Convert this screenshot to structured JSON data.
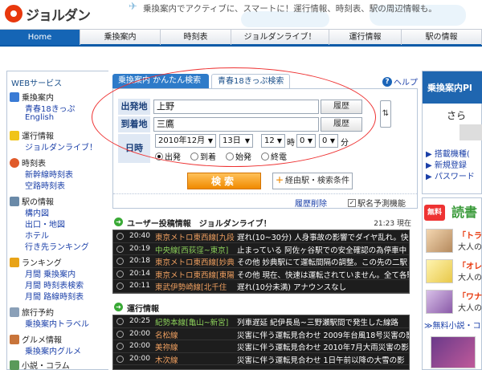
{
  "header": {
    "logo": "ジョルダン",
    "slogan": "乗換案内でアクティブに、スマートに！運行情報、時刻表、駅の周辺情報も。"
  },
  "nav": [
    {
      "label": "Home",
      "active": true
    },
    {
      "label": "乗換案内"
    },
    {
      "label": "時刻表"
    },
    {
      "label": "ジョルダンライブ！"
    },
    {
      "label": "運行情報"
    },
    {
      "label": "駅の情報"
    }
  ],
  "sidebar": {
    "title": "WEBサービス",
    "sections": [
      {
        "label": "乗換案内",
        "icon": "train-icon",
        "links": [
          "青春18きっぷ",
          "English"
        ]
      },
      {
        "label": "運行情報",
        "icon": "warning-icon",
        "links": [
          "ジョルダンライブ！"
        ]
      },
      {
        "label": "時刻表",
        "icon": "clock-icon",
        "links": [
          "新幹線時刻表",
          "空路時刻表"
        ]
      },
      {
        "label": "駅の情報",
        "icon": "station-icon",
        "links": [
          "構内図",
          "出口・地図",
          "ホテル",
          "行き先ランキング"
        ]
      },
      {
        "label": "ランキング",
        "icon": "crown-icon",
        "links": [
          "月間 乗換案内",
          "月間 時刻表検索",
          "月間 路線時刻表"
        ]
      },
      {
        "label": "旅行予約",
        "icon": "plane-icon",
        "links": [
          "乗換案内トラベル"
        ]
      },
      {
        "label": "グルメ情報",
        "icon": "food-icon",
        "links": [
          "乗換案内グルメ"
        ]
      },
      {
        "label": "小説・コラム",
        "icon": "book-icon",
        "links": []
      }
    ]
  },
  "search": {
    "tab_simple": "乗換案内 かんたん検索",
    "tab_seishun": "青春18きっぷ検索",
    "help": "ヘルプ",
    "from_label": "出発地",
    "from_value": "上野",
    "to_label": "到着地",
    "to_value": "三鷹",
    "history_btn": "履歴",
    "datetime_label": "日時",
    "year_month": "2010年12月",
    "day": "13日",
    "hour": "12",
    "hour_suffix": "時",
    "minute_tens": "0",
    "minute_ones": "0",
    "minute_suffix": "分",
    "radios": [
      "出発",
      "到着",
      "始発",
      "終電"
    ],
    "search_btn": "検索",
    "options_btn": "経由駅・検索条件",
    "history_delete": "履歴削除",
    "station_predict": "駅名予測機能"
  },
  "posts": {
    "title": "ユーザー投稿情報　ジョルダンライブ！",
    "time": "21:23 現在",
    "rows": [
      {
        "time": "20:40",
        "line": "東京メトロ東西線[九段",
        "text": "遅れ(10~30分) 人身事故の影響でダイヤ乱れ。快速"
      },
      {
        "time": "20:19",
        "line": "中央線[西荻窪~東京]",
        "text": "止まっている 阿佐ヶ谷駅での安全確認の為停車中",
        "green": true
      },
      {
        "time": "20:18",
        "line": "東京メトロ東西線[妙典",
        "text": "その他 妙典駅にて運転間隔の調整。この先の二駅と"
      },
      {
        "time": "20:14",
        "line": "東京メトロ東西線[東陽",
        "text": "その他 現在、快速は運転されていません。全て各駅停"
      },
      {
        "time": "20:11",
        "line": "東武伊勢崎線[北千住",
        "text": "遅れ(10分未満) アナウンスなし"
      }
    ]
  },
  "ops": {
    "title": "運行情報",
    "rows": [
      {
        "time": "20:25",
        "line": "紀勢本線[亀山~新宮]",
        "text": "列車遅延 紀伊長島~三野瀬駅間で発生した線路",
        "green": true
      },
      {
        "time": "20:00",
        "line": "名松線",
        "text": "災害に伴う運転見合わせ 2009年台風18号災害の影"
      },
      {
        "time": "20:00",
        "line": "美祢線",
        "text": "災害に伴う運転見合わせ 2010年7月大雨災害の影"
      },
      {
        "time": "20:00",
        "line": "木次線",
        "text": "災害に伴う運転見合わせ 1日午前以降の大雪の影"
      }
    ]
  },
  "right": {
    "banner": "乗換案内Pl",
    "sara": "さら",
    "links": [
      "搭載機種(",
      "新規登録",
      "パスワード"
    ],
    "badge": "無料",
    "yomi": "読書",
    "items": [
      {
        "q": "「トラッ",
        "s": "大人の"
      },
      {
        "q": "「オレン",
        "s": "大人の"
      },
      {
        "q": "「ワナビ",
        "s": "大人の"
      }
    ],
    "more": "≫無料小説・コ"
  },
  "colors": {
    "brand_blue": "#1565b5",
    "accent_orange": "#f08a00",
    "highlight_red": "#e33333"
  }
}
